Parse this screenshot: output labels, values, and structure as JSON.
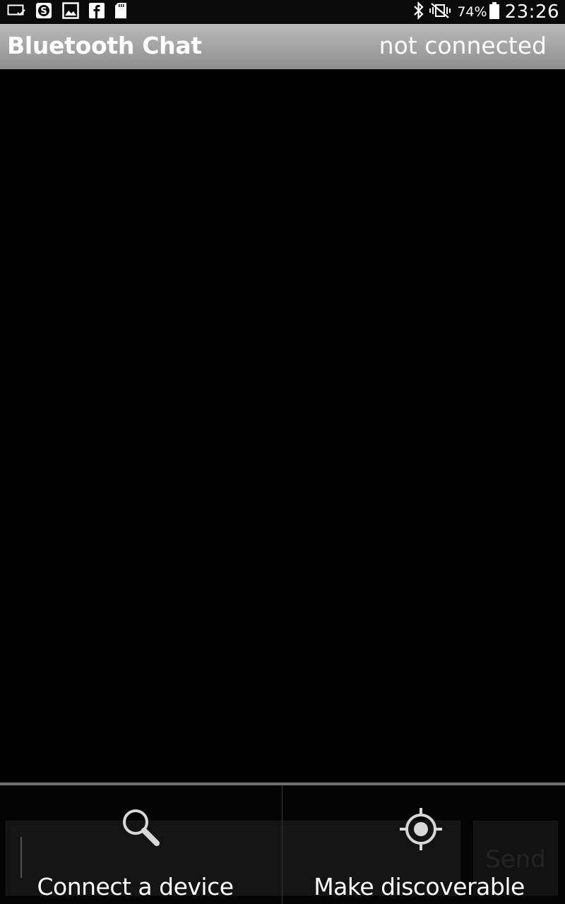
{
  "status_bar": {
    "battery_percent": "74%",
    "time": "23:26",
    "notification_icons": [
      "cast-icon",
      "skype-icon",
      "gallery-icon",
      "facebook-icon",
      "sd-card-icon"
    ],
    "system_icons": [
      "bluetooth-icon",
      "vibrate-icon",
      "battery-icon"
    ]
  },
  "app_bar": {
    "title": "Bluetooth Chat",
    "connection_status": "not connected"
  },
  "composer": {
    "send_label": "Send"
  },
  "options_menu": {
    "items": [
      {
        "label": "Connect a device",
        "icon": "search-icon"
      },
      {
        "label": "Make discoverable",
        "icon": "discoverable-icon"
      }
    ]
  },
  "colors": {
    "background": "#000000",
    "title_bar": "#a6a6a6",
    "text": "#ffffff"
  }
}
